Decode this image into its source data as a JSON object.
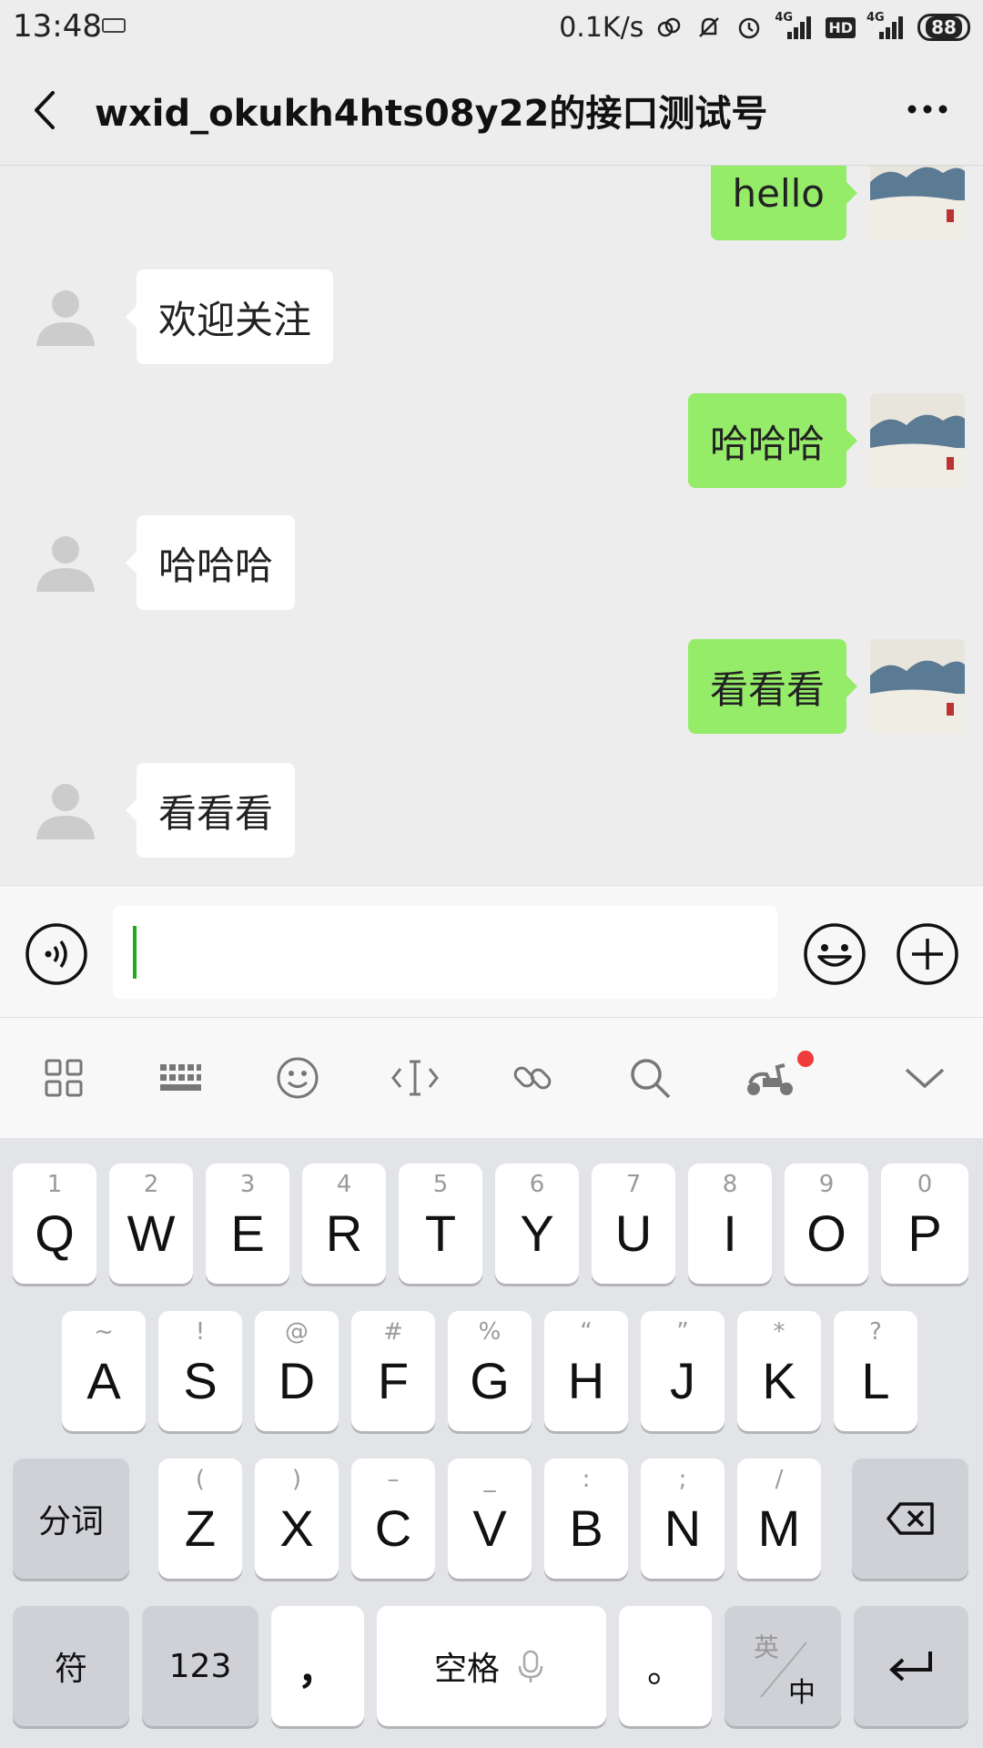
{
  "status_bar": {
    "time": "13:48",
    "speed": "0.1K/s",
    "network_a": "4G",
    "network_b": "4G",
    "hd": "HD",
    "battery": "88"
  },
  "header": {
    "title": "wxid_okukh4hts08y22的接口测试号"
  },
  "messages": [
    {
      "side": "self",
      "text": "hello"
    },
    {
      "side": "other",
      "text": "欢迎关注"
    },
    {
      "side": "self",
      "text": "哈哈哈"
    },
    {
      "side": "other",
      "text": "哈哈哈"
    },
    {
      "side": "self",
      "text": "看看看"
    },
    {
      "side": "other",
      "text": "看看看"
    }
  ],
  "input": {
    "value": ""
  },
  "ime_toolbar": {
    "icons": [
      "grid-icon",
      "keyboard-icon",
      "emoji-icon",
      "cursor-icon",
      "link-icon",
      "search-icon",
      "scooter-icon",
      "chevron-down-icon"
    ]
  },
  "keyboard": {
    "row1": [
      {
        "hint": "1",
        "key": "Q"
      },
      {
        "hint": "2",
        "key": "W"
      },
      {
        "hint": "3",
        "key": "E"
      },
      {
        "hint": "4",
        "key": "R"
      },
      {
        "hint": "5",
        "key": "T"
      },
      {
        "hint": "6",
        "key": "Y"
      },
      {
        "hint": "7",
        "key": "U"
      },
      {
        "hint": "8",
        "key": "I"
      },
      {
        "hint": "9",
        "key": "O"
      },
      {
        "hint": "0",
        "key": "P"
      }
    ],
    "row2": [
      {
        "hint": "~",
        "key": "A"
      },
      {
        "hint": "!",
        "key": "S"
      },
      {
        "hint": "@",
        "key": "D"
      },
      {
        "hint": "#",
        "key": "F"
      },
      {
        "hint": "%",
        "key": "G"
      },
      {
        "hint": "“",
        "key": "H"
      },
      {
        "hint": "”",
        "key": "J"
      },
      {
        "hint": "*",
        "key": "K"
      },
      {
        "hint": "?",
        "key": "L"
      }
    ],
    "row3": [
      {
        "hint": "(",
        "key": "Z"
      },
      {
        "hint": ")",
        "key": "X"
      },
      {
        "hint": "–",
        "key": "C"
      },
      {
        "hint": "_",
        "key": "V"
      },
      {
        "hint": ":",
        "key": "B"
      },
      {
        "hint": ";",
        "key": "N"
      },
      {
        "hint": "/",
        "key": "M"
      }
    ],
    "segment_label": "分词",
    "symbol_label": "符",
    "numeric_label": "123",
    "comma_label": "，",
    "space_label": "空格",
    "period_label": "。",
    "lang_en": "英",
    "lang_zh": "中"
  },
  "colors": {
    "self_bubble": "#95ec69",
    "other_bubble": "#ffffff",
    "caret": "#1aad19",
    "notify_dot": "#f03c3c"
  }
}
